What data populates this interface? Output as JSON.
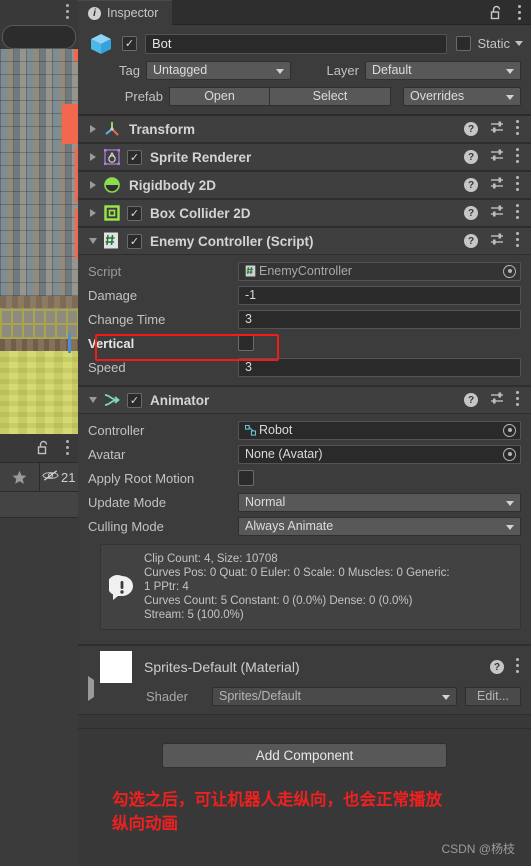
{
  "scene": {
    "search_placeholder": "",
    "overlay_counter": "21",
    "star_icon": "star-icon",
    "hidden_objects_icon": "eye-off-icon",
    "lock_icon": "lock-open-icon",
    "kebab_icon": "kebab-menu-icon"
  },
  "inspector": {
    "tab_label": "Inspector",
    "tab_icon": "info-circle-icon",
    "lock_icon": "lock-open-icon",
    "kebab_icon": "kebab-menu-icon"
  },
  "header": {
    "object_icon": "cube-icon",
    "enabled": true,
    "enabled_mark": "✓",
    "name": "Bot",
    "static_label": "Static",
    "static_checked": false,
    "tag_label": "Tag",
    "tag_value": "Untagged",
    "layer_label": "Layer",
    "layer_value": "Default",
    "prefab_label": "Prefab",
    "prefab_open": "Open",
    "prefab_select": "Select",
    "prefab_overrides": "Overrides"
  },
  "components": [
    {
      "title": "Transform",
      "icon": "transform-axis-icon",
      "expanded": false,
      "has_toggle": false,
      "checked": false
    },
    {
      "title": "Sprite Renderer",
      "icon": "sprite-renderer-icon",
      "expanded": false,
      "has_toggle": true,
      "checked": true
    },
    {
      "title": "Rigidbody 2D",
      "icon": "rigidbody-2d-icon",
      "expanded": false,
      "has_toggle": false,
      "checked": false
    },
    {
      "title": "Box Collider 2D",
      "icon": "box-collider-2d-icon",
      "expanded": false,
      "has_toggle": true,
      "checked": true
    }
  ],
  "enemy_controller": {
    "title": "Enemy Controller (Script)",
    "icon": "cs-script-icon",
    "checked": true,
    "check_mark": "✓",
    "fields": [
      {
        "label": "Script",
        "value": "EnemyController",
        "type": "object",
        "readonly": true,
        "icon": "cs-script-icon"
      },
      {
        "label": "Damage",
        "value": "-1",
        "type": "text"
      },
      {
        "label": "Change Time",
        "value": "3",
        "type": "text"
      },
      {
        "label": "Vertical",
        "value": "",
        "type": "checkbox",
        "checked": false,
        "highlighted": true
      },
      {
        "label": "Speed",
        "value": "3",
        "type": "text"
      }
    ]
  },
  "animator": {
    "title": "Animator",
    "icon": "animator-icon",
    "checked": true,
    "check_mark": "✓",
    "fields": [
      {
        "label": "Controller",
        "value": "Robot",
        "type": "object",
        "icon": "animator-controller-icon"
      },
      {
        "label": "Avatar",
        "value": "None (Avatar)",
        "type": "object",
        "icon": ""
      },
      {
        "label": "Apply Root Motion",
        "value": "",
        "type": "checkbox",
        "checked": false
      },
      {
        "label": "Update Mode",
        "value": "Normal",
        "type": "dropdown"
      },
      {
        "label": "Culling Mode",
        "value": "Always Animate",
        "type": "dropdown"
      }
    ],
    "info_icon": "warning-speech-icon",
    "info_lines": [
      "Clip Count: 4, Size: 10708",
      "Curves Pos: 0 Quat: 0 Euler: 0 Scale: 0 Muscles: 0 Generic:",
      "1 PPtr: 4",
      "Curves Count: 5 Constant: 0 (0.0%) Dense: 0 (0.0%)",
      "Stream: 5 (100.0%)"
    ]
  },
  "material": {
    "title": "Sprites-Default (Material)",
    "swatch_color": "#ffffff",
    "shader_label": "Shader",
    "shader_value": "Sprites/Default",
    "edit_label": "Edit...",
    "help_icon": "help-circle-icon",
    "kebab_icon": "kebab-menu-icon"
  },
  "add_component_label": "Add Component",
  "annotation": {
    "line1": "勾选之后，可让机器人走纵向，也会正常播放",
    "line2": "纵向动画",
    "color": "#ef2020"
  },
  "watermark": "CSDN @杨枝",
  "icons": {
    "help": "?",
    "settings": "settings-sliders-icon",
    "kebab": "kebab-menu-icon"
  }
}
